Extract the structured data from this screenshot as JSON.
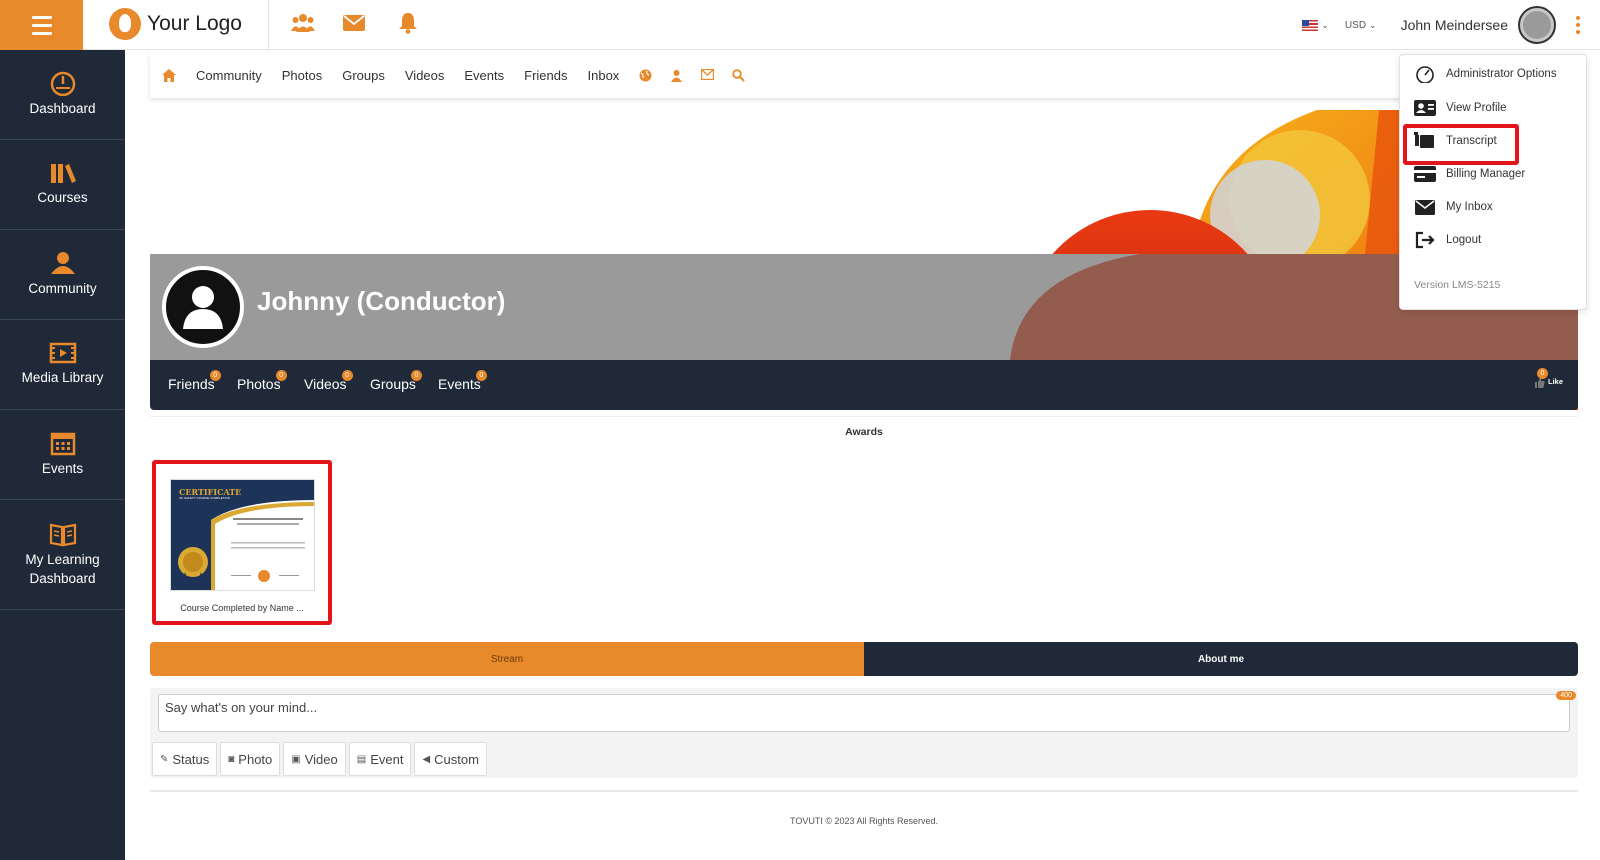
{
  "header": {
    "logo_text": "Your Logo",
    "currency": "USD",
    "user_name": "John Meindersee"
  },
  "sidebar": {
    "items": [
      {
        "label": "Dashboard",
        "icon": "speedometer-icon"
      },
      {
        "label": "Courses",
        "icon": "books-icon"
      },
      {
        "label": "Community",
        "icon": "community-icon"
      },
      {
        "label": "Media Library",
        "icon": "film-icon"
      },
      {
        "label": "Events",
        "icon": "calendar-icon"
      },
      {
        "label": "My Learning Dashboard",
        "icon": "open-book-icon"
      }
    ]
  },
  "community_nav": {
    "links": [
      "Community",
      "Photos",
      "Groups",
      "Videos",
      "Events",
      "Friends",
      "Inbox"
    ]
  },
  "profile": {
    "name": "Johnny (Conductor)",
    "tabs": [
      {
        "label": "Friends",
        "count": "0"
      },
      {
        "label": "Photos",
        "count": "0"
      },
      {
        "label": "Videos",
        "count": "0"
      },
      {
        "label": "Groups",
        "count": "0"
      },
      {
        "label": "Events",
        "count": "0"
      }
    ],
    "like_count": "0",
    "like_label": "Like"
  },
  "awards": {
    "title": "Awards",
    "items": [
      {
        "caption": "Course Completed by Name ...",
        "cert_title": "CERTIFICATE",
        "cert_subtitle": "OF SAFETY COURSE COMPLETION"
      }
    ]
  },
  "stream": {
    "tab_stream": "Stream",
    "tab_about": "About me"
  },
  "post": {
    "placeholder": "Say what's on your mind...",
    "char_limit": "400",
    "buttons": [
      "Status",
      "Photo",
      "Video",
      "Event",
      "Custom"
    ]
  },
  "footer": {
    "text": "TOVUTI © 2023 All Rights Reserved."
  },
  "user_menu": {
    "items": [
      "Administrator Options",
      "View Profile",
      "Transcript",
      "Billing Manager",
      "My Inbox",
      "Logout"
    ],
    "version": "Version LMS-5215"
  },
  "colors": {
    "accent": "#e8892b",
    "dark": "#1f2937",
    "highlight": "#e4141b"
  }
}
